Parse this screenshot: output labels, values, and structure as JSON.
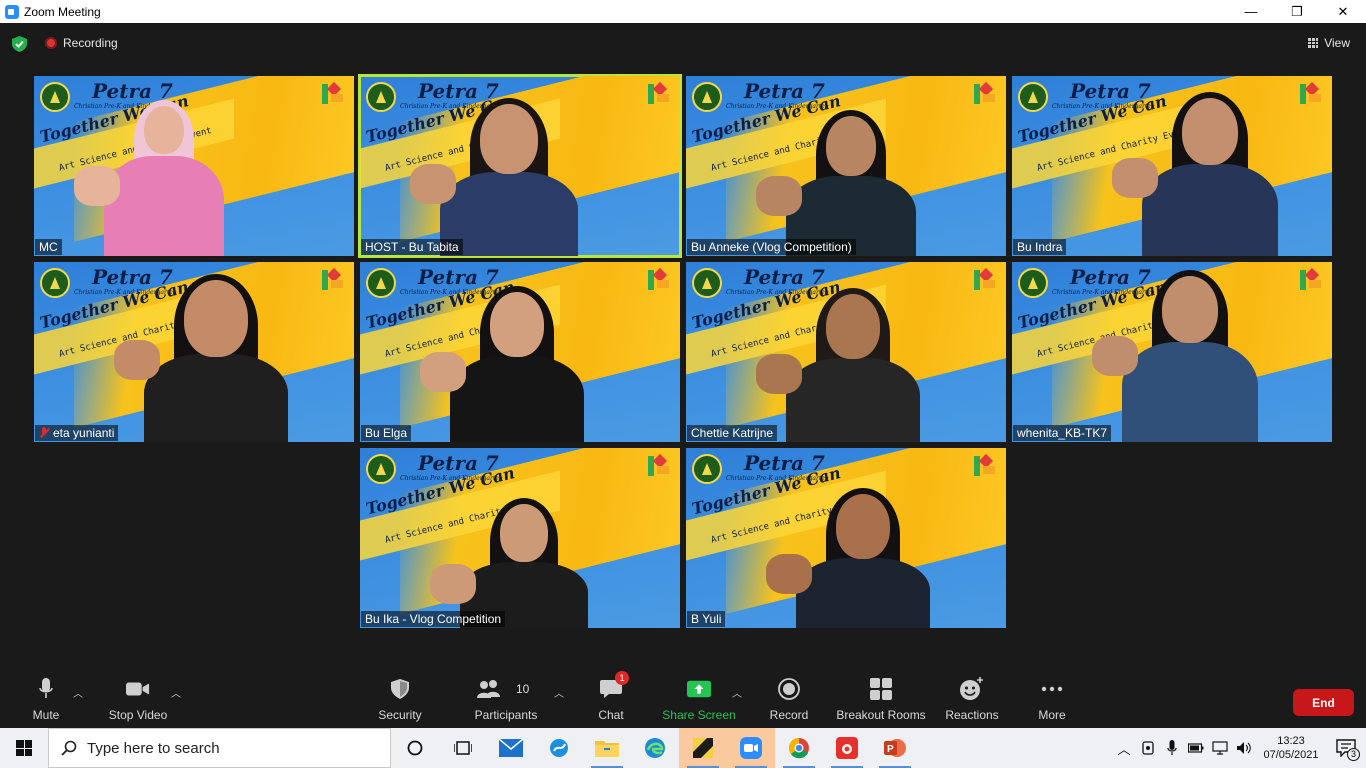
{
  "window": {
    "title": "Zoom Meeting",
    "min": "—",
    "max": "❐",
    "close": "✕"
  },
  "top": {
    "recording": "Recording",
    "view": "View"
  },
  "tile_branding": {
    "brand": "Petra 7",
    "subtitle": "Christian Pre-K and Kindergarten",
    "slogan": "Together We Can",
    "event": "Art Science and Charity Event"
  },
  "participants": [
    {
      "name": "MC",
      "muted": false,
      "active": false
    },
    {
      "name": "HOST - Bu Tabita",
      "muted": false,
      "active": true
    },
    {
      "name": "Bu Anneke (Vlog Competition)",
      "muted": false,
      "active": false
    },
    {
      "name": "Bu Indra",
      "muted": false,
      "active": false
    },
    {
      "name": "eta yunianti",
      "muted": true,
      "active": false
    },
    {
      "name": "Bu Elga",
      "muted": false,
      "active": false
    },
    {
      "name": "Chettie Katrijne",
      "muted": false,
      "active": false
    },
    {
      "name": "whenita_KB-TK7",
      "muted": false,
      "active": false
    },
    {
      "name": "Bu Ika - Vlog Competition",
      "muted": false,
      "active": false
    },
    {
      "name": "B Yuli",
      "muted": false,
      "active": false
    }
  ],
  "toolbar": {
    "mute": "Mute",
    "stop_video": "Stop Video",
    "security": "Security",
    "participants": "Participants",
    "participants_count": "10",
    "chat": "Chat",
    "chat_badge": "1",
    "share_screen": "Share Screen",
    "record": "Record",
    "breakout_rooms": "Breakout Rooms",
    "reactions": "Reactions",
    "more": "More",
    "end": "End"
  },
  "taskbar": {
    "search_placeholder": "Type here to search",
    "time": "13:23",
    "date": "07/05/2021",
    "notifications": "3"
  },
  "colors": {
    "accent_green": "#25c453",
    "end_red": "#c8171b",
    "active_speaker": "#b7e73b"
  }
}
